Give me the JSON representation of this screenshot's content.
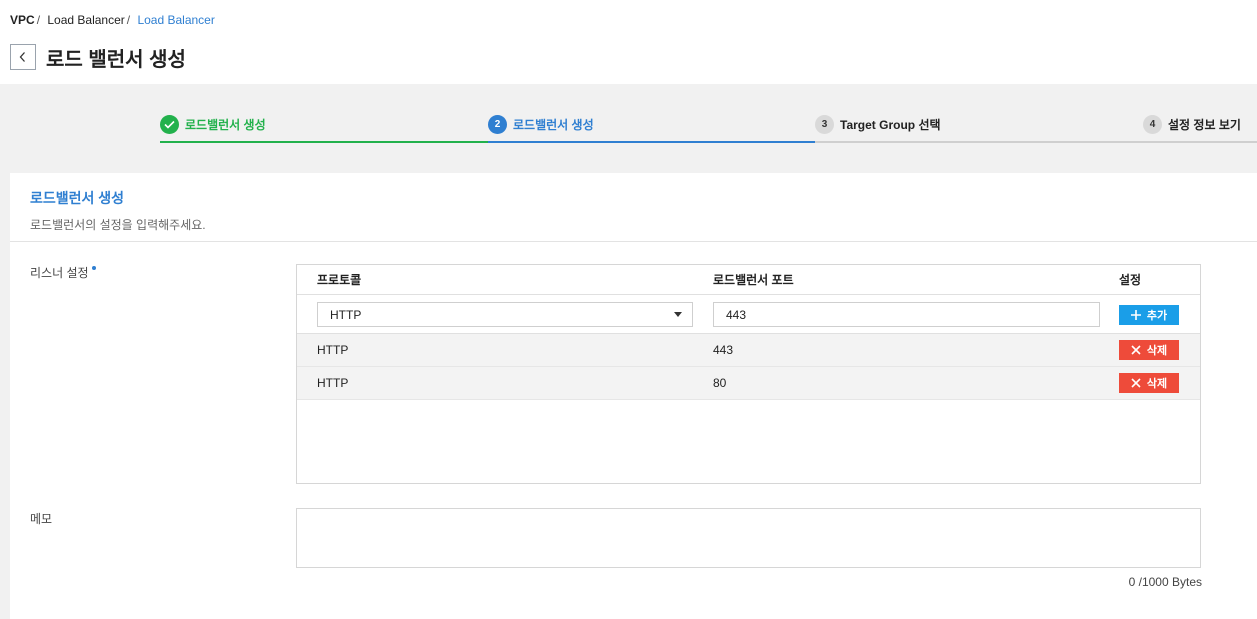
{
  "breadcrumb": {
    "items": [
      "VPC",
      "Load Balancer",
      "Load Balancer"
    ],
    "separator": "/"
  },
  "page": {
    "title": "로드 밸런서 생성"
  },
  "steps": [
    {
      "number": "1",
      "label": "로드밸런서 생성",
      "state": "done"
    },
    {
      "number": "2",
      "label": "로드밸런서 생성",
      "state": "active"
    },
    {
      "number": "3",
      "label": "Target Group 선택",
      "state": "todo"
    },
    {
      "number": "4",
      "label": "설정 정보 보기",
      "state": "todo"
    }
  ],
  "section": {
    "title": "로드밸런서 생성",
    "description": "로드밸런서의 설정을 입력해주세요."
  },
  "listener": {
    "label": "리스너 설정",
    "columns": {
      "protocol": "프로토콜",
      "port": "로드밸런서 포트",
      "action": "설정"
    },
    "input": {
      "protocol": "HTTP",
      "port": "443"
    },
    "add_button": "추가",
    "rows": [
      {
        "protocol": "HTTP",
        "port": "443",
        "action": "삭제"
      },
      {
        "protocol": "HTTP",
        "port": "80",
        "action": "삭제"
      }
    ]
  },
  "memo": {
    "label": "메모",
    "value": "",
    "counter": "0 /1000 Bytes"
  },
  "colors": {
    "accent": "#2f7fd1",
    "success": "#22b14c",
    "add_button": "#1a9ee8",
    "delete_button": "#ee4b3a"
  }
}
